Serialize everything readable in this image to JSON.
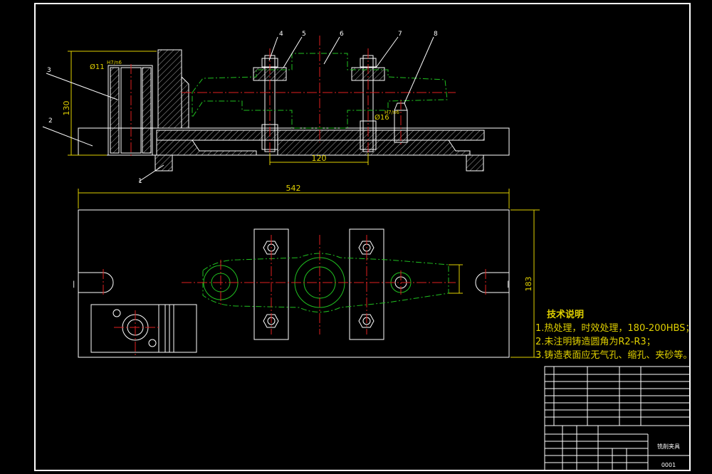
{
  "part_numbers": [
    "1",
    "2",
    "3",
    "4",
    "5",
    "6",
    "7",
    "8"
  ],
  "dimensions": {
    "height_130": "130",
    "length_120": "120",
    "length_542": "542",
    "width_183": "183",
    "fit_11": "Ø11",
    "fit_11_tol": "H7/n6",
    "fit_16": "Ø16",
    "fit_16_tol": "H7/n6"
  },
  "technical_notes": {
    "title": "技术说明",
    "items": [
      "1.热处理，时效处理，180-200HBS；",
      "2.未注明铸造圆角为R2-R3；",
      "3.铸造表面应无气孔、缩孔、夹砂等。"
    ]
  },
  "title_block": {
    "drawing_code": "0001",
    "drawing_name": "铣削夹具"
  },
  "colors": {
    "background": "#000000",
    "outline": "#ffffff",
    "workpiece": "#20c020",
    "centerline": "#e02020",
    "dimension": "#e0d000"
  }
}
